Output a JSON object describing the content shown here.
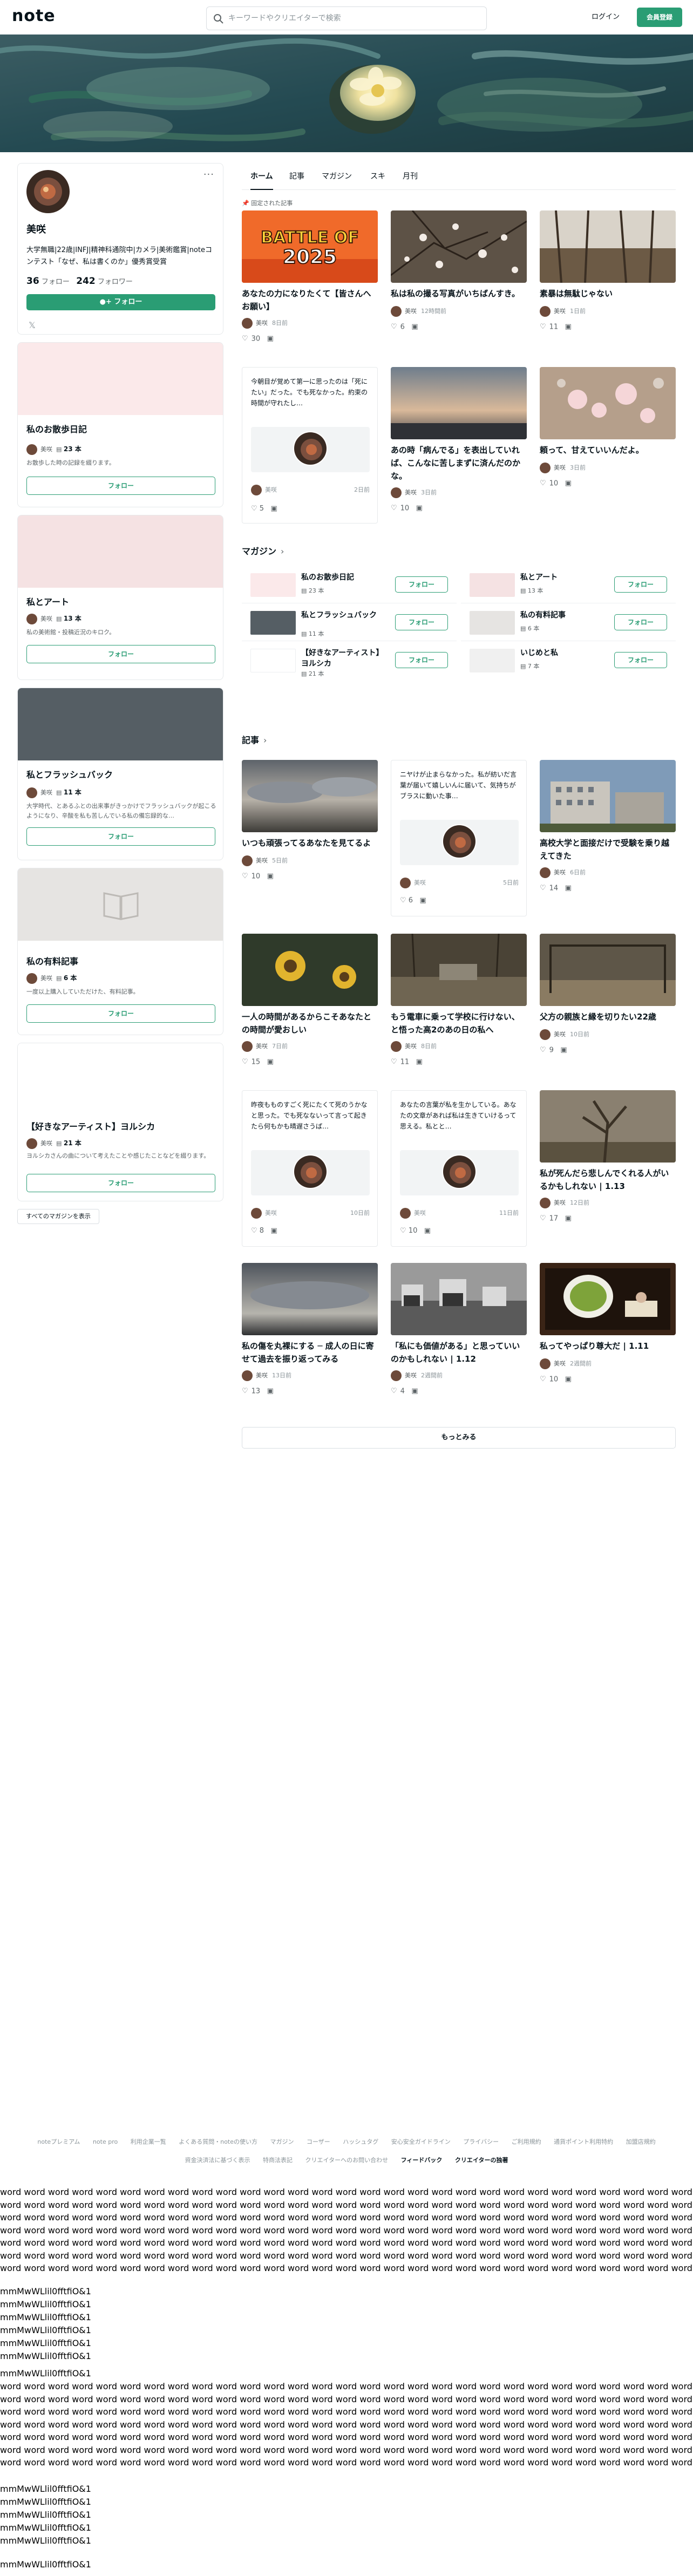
{
  "header": {
    "logo": "note",
    "search_placeholder": "キーワードやクリエイターで検索",
    "login_label": "ログイン",
    "signup_label": "会員登録"
  },
  "profile": {
    "name": "美咲",
    "bio": "大学無職|22歳|INFJ|精神科通院中|カメラ|美術鑑賞|noteコンテスト「なぜ、私は書くのか」優秀賞受賞",
    "following_count": "36",
    "following_label": "フォロー",
    "followers_count": "242",
    "followers_label": "フォロワー",
    "follow_label": "フォロー",
    "x_label": "𝕏",
    "more_label": "···"
  },
  "sidebar_magazines": [
    {
      "title": "私のお散歩日記",
      "author": "美咲",
      "count": "23 本",
      "desc": "お散歩した時の記録を綴ります。",
      "follow": "フォロー",
      "cover": "#fbe9ea"
    },
    {
      "title": "私とアート",
      "author": "美咲",
      "count": "13 本",
      "desc": "私の美術館・投稿近況のキロク。",
      "follow": "フォロー",
      "cover": "#f5e2e3"
    },
    {
      "title": "私とフラッシュバック",
      "author": "美咲",
      "count": "11 本",
      "desc": "大学時代、とあるふとの出来事がきっかけでフラッシュバックが起こるようになり、辛酸を私も苦しんでいる私の備忘録的な…",
      "follow": "フォロー",
      "cover": "#555e64"
    },
    {
      "title": "私の有料記事",
      "author": "美咲",
      "count": "6 本",
      "desc": "一度以上購入していただけた、有料記事。",
      "follow": "フォロー",
      "cover": "#e6e4e2"
    },
    {
      "title": "【好きなアーティスト】ヨルシカ",
      "author": "美咲",
      "count": "21 本",
      "desc": "ヨルシカさんの曲について考えたことや感じたことなどを綴ります。",
      "follow": "フォロー",
      "cover": "#ffffff"
    }
  ],
  "all_magazines_label": "すべてのマガジンを表示",
  "tabs": [
    "ホーム",
    "記事",
    "マガジン",
    "スキ",
    "月刊"
  ],
  "pinned_note": "固定された記事",
  "pinned_articles": [
    {
      "title": "あなたの力になりたくて【皆さんへお願い】",
      "author": "美咲",
      "date": "8日前",
      "likes": "30",
      "thumb": "battle"
    },
    {
      "title": "私は私の撮る写真がいちばんすき。",
      "author": "美咲",
      "date": "12時間前",
      "likes": "6",
      "thumb": "blossom"
    },
    {
      "title": "素暴は無駄じゃない",
      "author": "美咲",
      "date": "1日前",
      "likes": "11",
      "thumb": "trees"
    },
    {
      "title": "",
      "text": "今朝目が覚めて第一に思ったのは「死にたい」だった。でも死なかった。約束の時間が守れたし…",
      "author": "美咲",
      "date": "2日前",
      "likes": "5",
      "thumb": "text"
    },
    {
      "title": "あの時「病んでる」を表出していれば、こんなに苦しまずに済んだのかな。",
      "author": "美咲",
      "date": "3日前",
      "likes": "10",
      "thumb": "sky"
    },
    {
      "title": "頼って、甘えていいんだよ。",
      "author": "美咲",
      "date": "3日前",
      "likes": "10",
      "thumb": "pinkflower"
    }
  ],
  "magazines_section": "マガジン",
  "magazine_rows": [
    {
      "title": "私のお散歩日記",
      "count": "23 本",
      "follow": "フォロー",
      "cover": "#fbe9ea"
    },
    {
      "title": "私とアート",
      "count": "13 本",
      "follow": "フォロー",
      "cover": "#f5e2e3"
    },
    {
      "title": "私とフラッシュバック",
      "count": "11 本",
      "follow": "フォロー",
      "cover": "#555e64"
    },
    {
      "title": "私の有料記事",
      "count": "6 本",
      "follow": "フォロー",
      "cover": "#e6e4e2"
    },
    {
      "title": "【好きなアーティスト】ヨルシカ",
      "count": "21 本",
      "follow": "フォロー",
      "cover": "#ffffff"
    },
    {
      "title": "いじめと私",
      "count": "7 本",
      "follow": "フォロー",
      "cover": "#f0f0f0"
    }
  ],
  "articles_section": "記事",
  "articles": [
    {
      "title": "いつも頑張ってるあなたを見てるよ",
      "author": "美咲",
      "date": "5日前",
      "likes": "10",
      "thumb": "clouds"
    },
    {
      "title": "",
      "text": "ニヤけが止まらなかった。私が紡いだ言葉が届いて嬉しいんに届いて、気持ちがブラスに動いた事…",
      "author": "美咲",
      "date": "5日前",
      "likes": "6",
      "thumb": "text"
    },
    {
      "title": "高校大学と面接だけで受験を乗り越えてきた",
      "author": "美咲",
      "date": "6日前",
      "likes": "14",
      "thumb": "bldg"
    },
    {
      "title": "一人の時間があるからこそあなたとの時間が愛おしい",
      "author": "美咲",
      "date": "7日前",
      "likes": "15",
      "thumb": "sunflower"
    },
    {
      "title": "もう電車に乗って学校に行けない、と悟った高2のあの日の私へ",
      "author": "美咲",
      "date": "8日前",
      "likes": "11",
      "thumb": "dusk"
    },
    {
      "title": "父方の親族と縁を切りたい22歳",
      "author": "美咲",
      "date": "10日前",
      "likes": "9",
      "thumb": "park"
    },
    {
      "title": "",
      "text": "昨夜もものすごく死にたくて死のうかなと思った。でも死なないって言って起きたら何もかも晴遅さうぱ…",
      "author": "美咲",
      "date": "10日前",
      "likes": "8",
      "thumb": "text"
    },
    {
      "title": "",
      "text": "あなたの言葉が私を生かしている。あなたの文章があれば私は生きていけるって思える。私とと…",
      "author": "美咲",
      "date": "11日前",
      "likes": "10",
      "thumb": "text"
    },
    {
      "title": "私が死んだら悲しんでくれる人がいるかもしれない | 1.13",
      "author": "美咲",
      "date": "12日前",
      "likes": "17",
      "thumb": "parktree"
    },
    {
      "title": "私の傷を丸裸にする ─ 成人の日に寄せて過去を振り返ってみる",
      "author": "美咲",
      "date": "13日前",
      "likes": "13",
      "thumb": "sky2"
    },
    {
      "title": "「私にも価値がある」と思っていいのかもしれない | 1.12",
      "author": "美咲",
      "date": "2週間前",
      "likes": "4",
      "thumb": "street"
    },
    {
      "title": "私ってやっぱり尊大だ | 1.11",
      "author": "美咲",
      "date": "2週間前",
      "likes": "10",
      "thumb": "tea"
    }
  ],
  "more_label": "もっとみる",
  "footer": {
    "row1": [
      "noteプレミアム",
      "note pro",
      "利用企業一覧",
      "よくある質問・noteの使い方",
      "マガジン",
      "コーザー",
      "ハッシュタグ",
      "安心安全ガイドライン",
      "プライバシー",
      "ご利用規約",
      "通貨ポイント利用特約",
      "加盟店規約"
    ],
    "row2": [
      "資金決済法に基づく表示",
      "特商法表記",
      "クリエイターへのお問い合わせ"
    ],
    "row2_bold": [
      "フィードバック",
      "クリエイターの独著"
    ]
  },
  "font_test": {
    "word_line": "word word word word word word word word word word word word word word word word word word word word word word word word word word word word word word word word word word word word word word word word word word word word word word word word word word word word word word word word word word word word word word word word word word word word word word word word word word word word word word word word word word word word word word word word word word word word word word word word word word word word word word word word word word word word word word word word word word word word word word word word word word word word word word word word word word word word word word word word word word word word word word word word word word word word word word word word word word word word word word word word word word word word word word word word word word word word word word word word word word word word word word word word word word word word word word word word word word word word word word word word word word word word word word word word word word word word word word word word word word word word word word word word word word word word word word word word word word word word word word word word word word word word word",
    "glyph_lines": [
      "mmMwWLlil0fftfiO&1",
      "mmMwWLlil0fftfiO&1",
      "mmMwWLlil0fftfiO&1",
      "mmMwWLlil0fftfiO&1",
      "mmMwWLlil0fftfiO&1",
      "mmMwWLlil0fftfiO&1"
    ],
    "single_line": "mmMwWLlil0fftfiO&1"
  }
}
